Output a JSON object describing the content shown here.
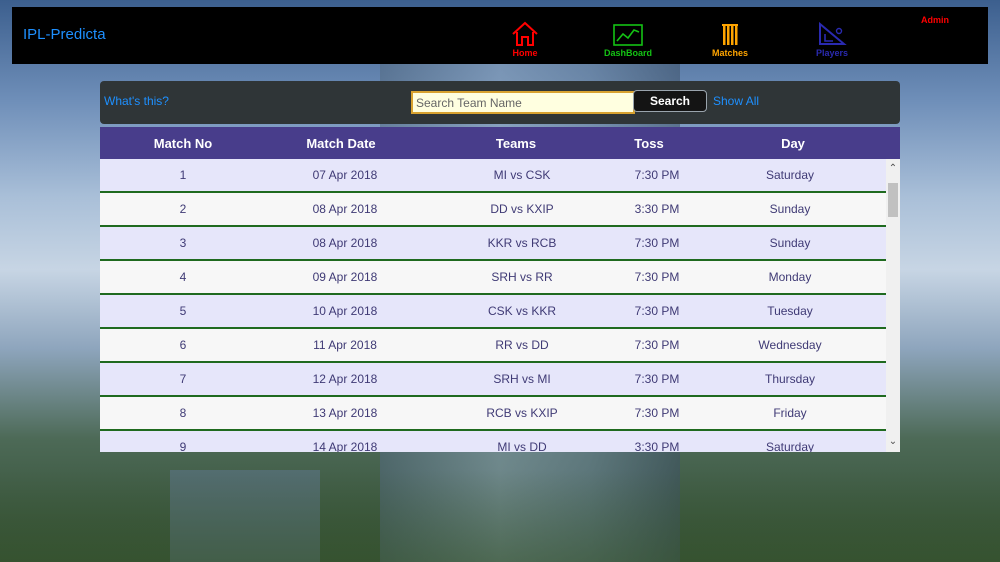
{
  "nav": {
    "brand": "IPL-Predicta",
    "items": [
      {
        "label": "Home",
        "icon": "home-icon",
        "color": "#ff0000"
      },
      {
        "label": "DashBoard",
        "icon": "chart-icon",
        "color": "#14c214"
      },
      {
        "label": "Matches",
        "icon": "stumps-icon",
        "color": "#ffa500"
      },
      {
        "label": "Players",
        "icon": "bat-ball-icon",
        "color": "#2a2ab0"
      }
    ],
    "admin": "Admin"
  },
  "search": {
    "whats_this": "What's this?",
    "placeholder": "Search Team Name",
    "button": "Search",
    "show_all": "Show All"
  },
  "table": {
    "headers": [
      "Match No",
      "Match Date",
      "Teams",
      "Toss",
      "Day"
    ],
    "rows": [
      [
        "1",
        "07 Apr 2018",
        "MI vs CSK",
        "7:30 PM",
        "Saturday"
      ],
      [
        "2",
        "08 Apr 2018",
        "DD vs KXIP",
        "3:30 PM",
        "Sunday"
      ],
      [
        "3",
        "08 Apr 2018",
        "KKR vs RCB",
        "7:30 PM",
        "Sunday"
      ],
      [
        "4",
        "09 Apr 2018",
        "SRH vs RR",
        "7:30 PM",
        "Monday"
      ],
      [
        "5",
        "10 Apr 2018",
        "CSK vs KKR",
        "7:30 PM",
        "Tuesday"
      ],
      [
        "6",
        "11 Apr 2018",
        "RR vs DD",
        "7:30 PM",
        "Wednesday"
      ],
      [
        "7",
        "12 Apr 2018",
        "SRH vs MI",
        "7:30 PM",
        "Thursday"
      ],
      [
        "8",
        "13 Apr 2018",
        "RCB vs KXIP",
        "7:30 PM",
        "Friday"
      ],
      [
        "9",
        "14 Apr 2018",
        "MI vs DD",
        "3:30 PM",
        "Saturday"
      ]
    ]
  }
}
